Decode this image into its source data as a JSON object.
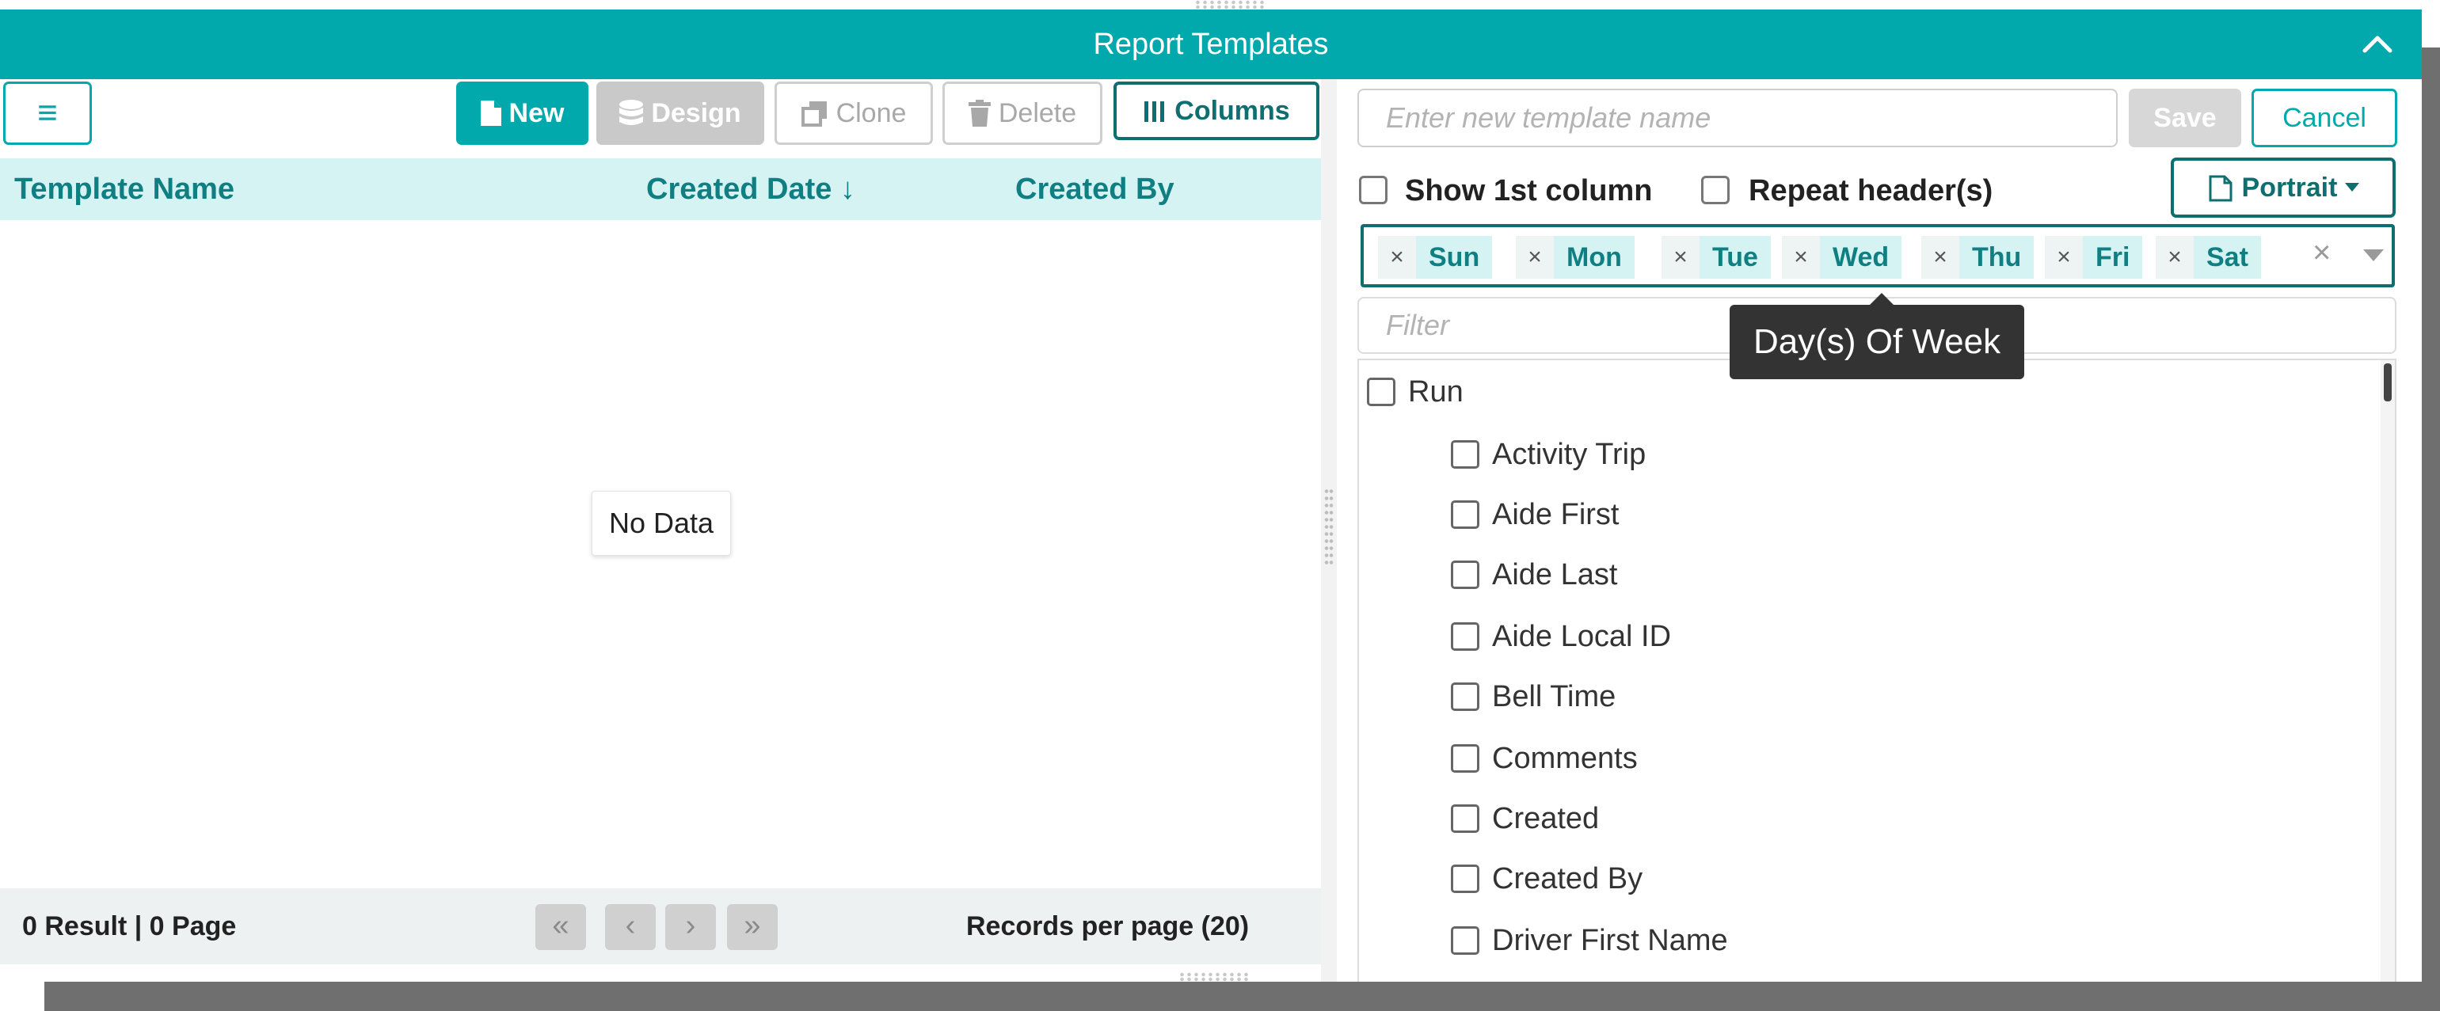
{
  "window": {
    "title": "Report Templates"
  },
  "toolbar": {
    "menu_icon": "hamburger-icon",
    "new_label": "New",
    "design_label": "Design",
    "clone_label": "Clone",
    "delete_label": "Delete",
    "columns_label": "Columns"
  },
  "grid": {
    "columns": [
      {
        "label": "Template Name"
      },
      {
        "label": "Created Date",
        "sort": "desc"
      },
      {
        "label": "Created By"
      }
    ],
    "empty_text": "No Data"
  },
  "footer": {
    "result_text": "0 Result | 0 Page",
    "records_per_page": "Records per page (20)"
  },
  "editor": {
    "template_name_placeholder": "Enter new template name",
    "save_label": "Save",
    "cancel_label": "Cancel",
    "show_first_column_label": "Show 1st column",
    "show_first_column_checked": false,
    "repeat_headers_label": "Repeat header(s)",
    "repeat_headers_checked": false,
    "orientation_label": "Portrait",
    "days": [
      "Sun",
      "Mon",
      "Tue",
      "Wed",
      "Thu",
      "Fri",
      "Sat"
    ],
    "days_tooltip": "Day(s) Of Week",
    "filter_placeholder": "Filter",
    "fields": {
      "group": "Run",
      "items": [
        "Activity Trip",
        "Aide First",
        "Aide Last",
        "Aide Local ID",
        "Bell Time",
        "Comments",
        "Created",
        "Created By",
        "Driver First Name"
      ]
    }
  },
  "colors": {
    "accent": "#01a9ac",
    "accent_dark": "#0f6e70",
    "header_bg": "#d6f3f4"
  }
}
